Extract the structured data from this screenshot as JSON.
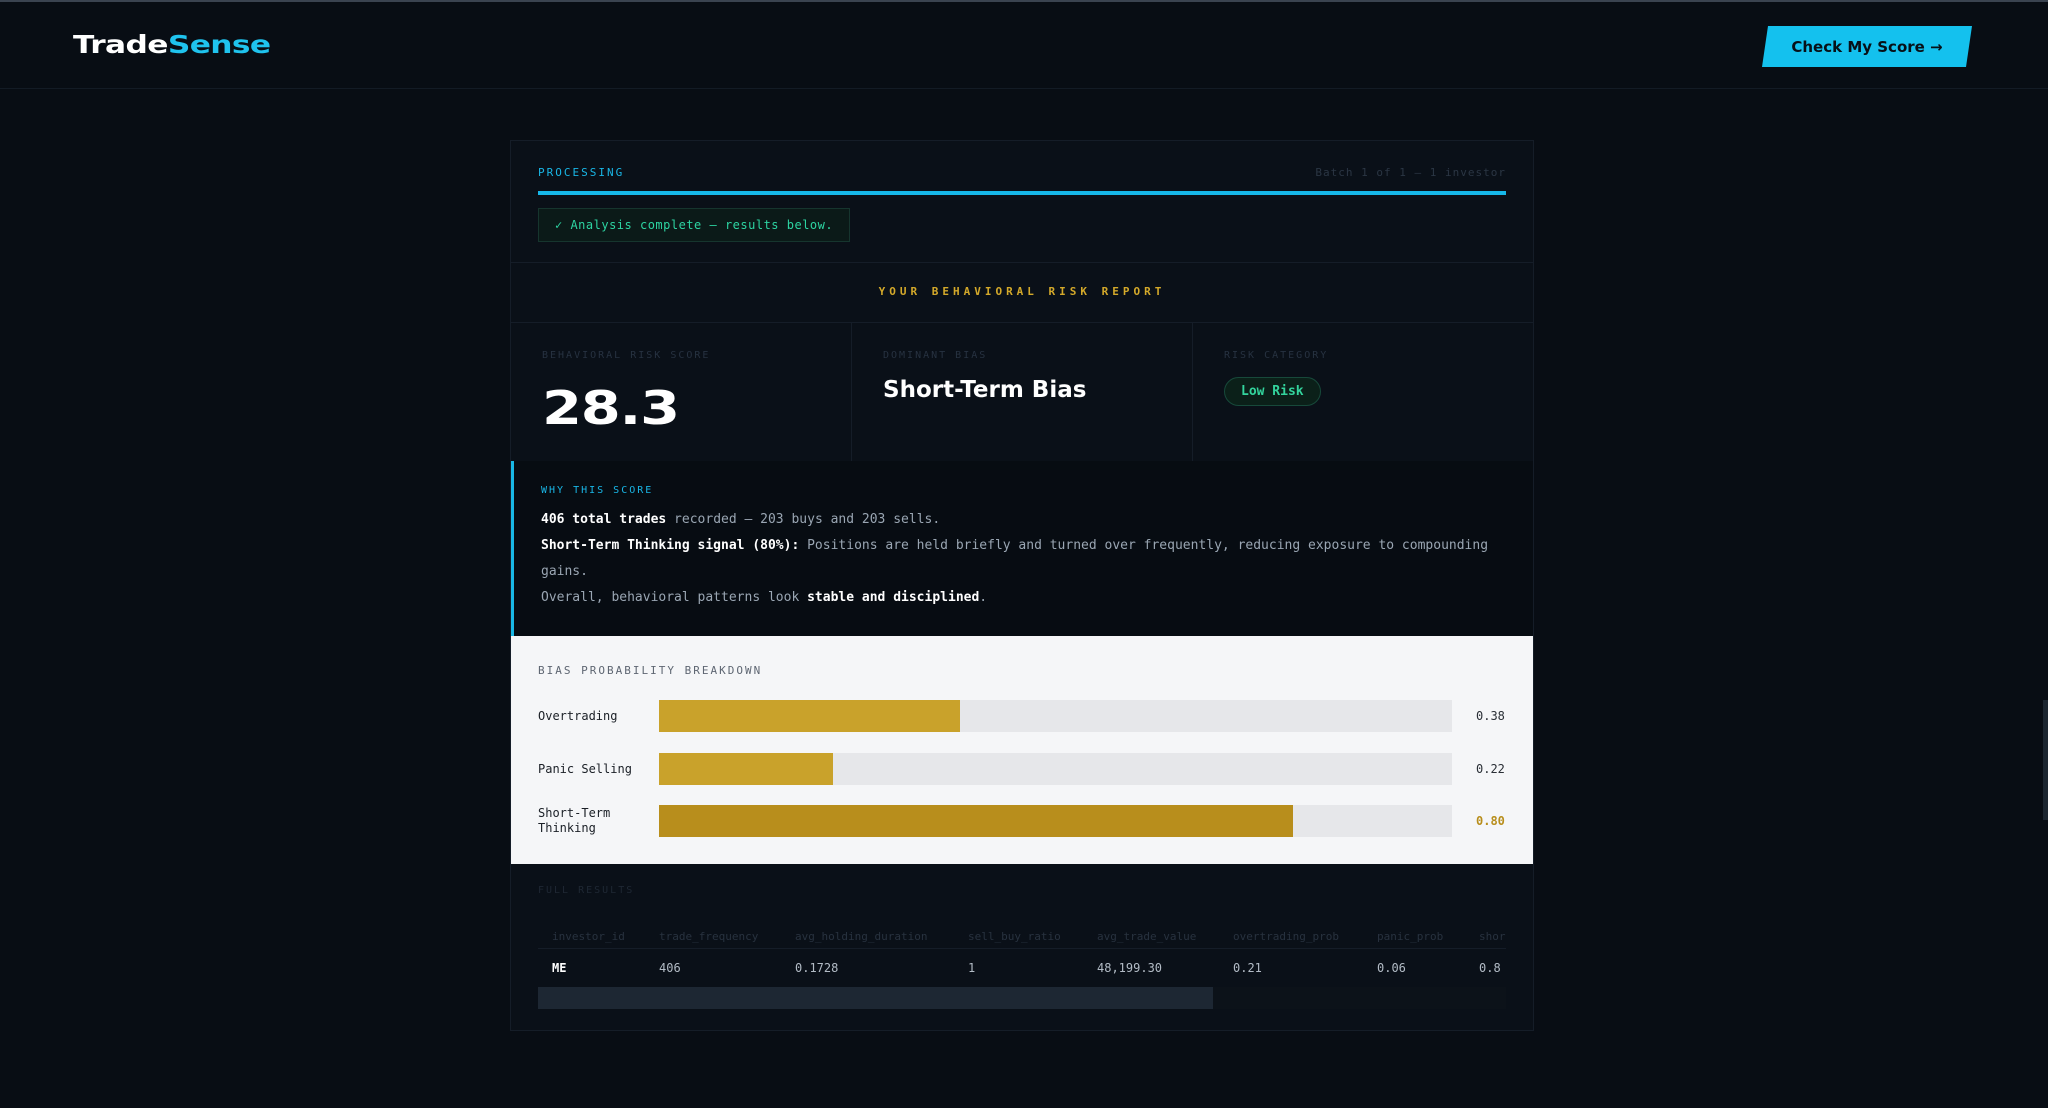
{
  "app": {
    "logo_part1": "Trade",
    "logo_part2": "Sense",
    "cta_label": "Check My Score →"
  },
  "processing": {
    "label": "PROCESSING",
    "batch": "Batch 1 of 1 — 1 investor",
    "progress": 1.0,
    "complete_msg": "✓ Analysis complete — results below."
  },
  "report": {
    "title": "YOUR BEHAVIORAL RISK REPORT",
    "score_label": "BEHAVIORAL RISK SCORE",
    "score": "28.3",
    "bias_label": "DOMINANT BIAS",
    "bias": "Short-Term Bias",
    "category_label": "RISK CATEGORY",
    "category": "Low Risk"
  },
  "why": {
    "label": "WHY THIS SCORE",
    "l1_bold": "406 total trades",
    "l1_rest": " recorded — 203 buys and 203 sells.",
    "l2_bold": "Short-Term Thinking signal (80%):",
    "l2_rest": " Positions are held briefly and turned over frequently, reducing exposure to compounding gains.",
    "l3_pre": "Overall, behavioral patterns look ",
    "l3_bold": "stable and disciplined",
    "l3_post": "."
  },
  "breakdown": {
    "label": "BIAS PROBABILITY BREAKDOWN",
    "items": [
      {
        "name": "Overtrading",
        "value": 0.38,
        "display": "0.38"
      },
      {
        "name": "Panic Selling",
        "value": 0.22,
        "display": "0.22"
      },
      {
        "name": "Short-Term Thinking",
        "value": 0.8,
        "display": "0.80"
      }
    ]
  },
  "full_results": {
    "label": "FULL RESULTS",
    "columns": [
      "investor_id",
      "trade_frequency",
      "avg_holding_duration",
      "sell_buy_ratio",
      "avg_trade_value",
      "overtrading_prob",
      "panic_prob",
      "shor"
    ],
    "rows": [
      [
        "ME",
        "406",
        "0.1728",
        "1",
        "48,199.30",
        "0.21",
        "0.06",
        "0.8"
      ]
    ]
  },
  "colors": {
    "accent": "#16b8ea",
    "gold": "#c9a22b",
    "success": "#33d49d",
    "background": "#080d14"
  }
}
